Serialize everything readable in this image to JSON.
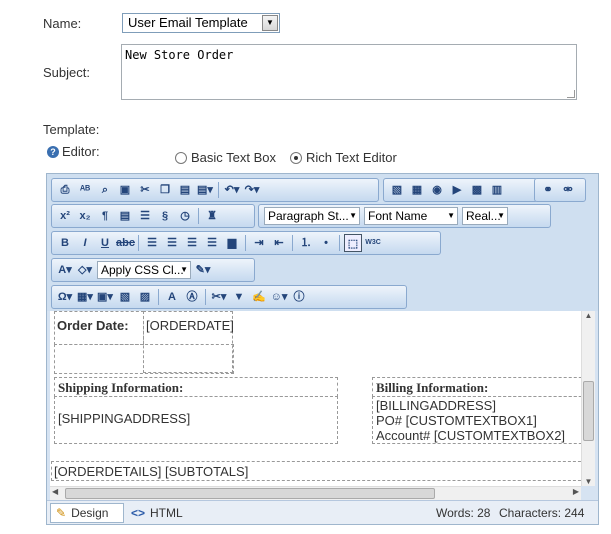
{
  "form": {
    "name_label": "Name:",
    "name_value": "User Email Template",
    "subject_label": "Subject:",
    "subject_value": "New Store Order",
    "template_label": "Template:",
    "editor_label": "Editor:",
    "editor_options": [
      "Basic Text Box",
      "Rich Text Editor"
    ],
    "editor_selected": "Rich Text Editor"
  },
  "toolbar": {
    "paragraph_style": "Paragraph St...",
    "font_name": "Font Name",
    "font_size": "Real...",
    "css_class": "Apply CSS Cl..."
  },
  "content": {
    "order_date_label": "Order Date:",
    "order_date_value": "[ORDERDATE]",
    "shipping_header": "Shipping Information:",
    "billing_header": "Billing Information:",
    "shipping_address": "[SHIPPINGADDRESS]",
    "billing_address": "[BILLINGADDRESS]",
    "po_line": "PO#  [CUSTOMTEXTBOX1]",
    "account_line": "Account#  [CUSTOMTEXTBOX2]",
    "order_details": "[ORDERDETAILS] [SUBTOTALS]"
  },
  "bottom": {
    "design_tab": "Design",
    "html_tab": "HTML",
    "words": "Words: 28",
    "characters": "Characters: 244"
  }
}
